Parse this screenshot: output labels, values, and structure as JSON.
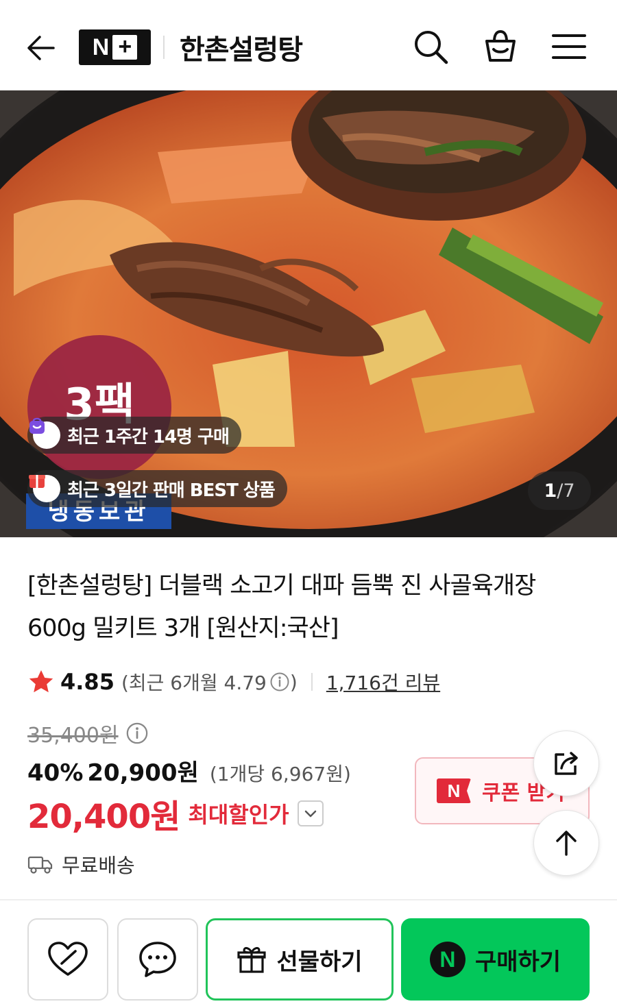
{
  "header": {
    "brand_badge": "N",
    "brand_plus": "+",
    "store_name": "한촌설렁탕"
  },
  "hero": {
    "badge_count_text": "3팩",
    "badge_storage_text": "냉동보관",
    "recent_purchase_pill": "최근 1주간 14명 구매",
    "best_pill": "최근 3일간 판매 BEST 상품",
    "slide_current": "1",
    "slide_total": "/7"
  },
  "product": {
    "title": "[한촌설렁탕] 더블랙 소고기 대파 듬뿍 진 사골육개장 600g 밀키트 3개 [원산지:국산]",
    "rating_score": "4.85",
    "rating_recent": "(최근 6개월 4.79",
    "rating_recent_close": ")",
    "review_count": "1,716건 리뷰",
    "original_price": "35,400원",
    "discount_percent": "40%",
    "sale_price": "20,900원",
    "unit_price": "(1개당 6,967원)",
    "max_discount_price": "20,400원",
    "max_discount_label": "최대할인가",
    "coupon_badge": "N",
    "coupon_label": "쿠폰 받기",
    "shipping": "무료배송"
  },
  "bottom_bar": {
    "gift_label": "선물하기",
    "buy_badge": "N",
    "buy_label": "구매하기"
  },
  "colors": {
    "naver_green": "#03c75a",
    "sale_red": "#e22a3a",
    "coupon_bg": "#fff6f7"
  }
}
